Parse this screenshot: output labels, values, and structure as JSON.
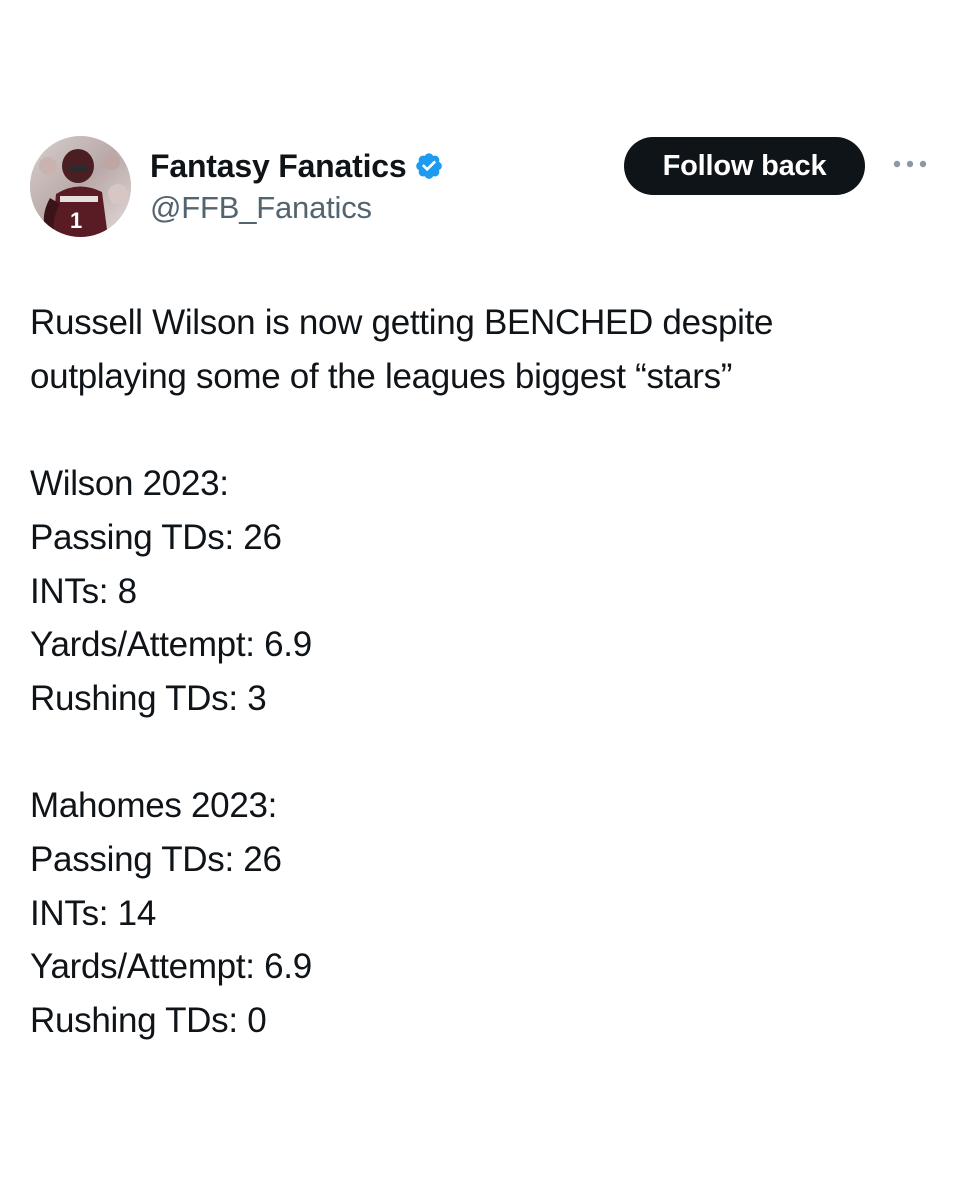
{
  "author": {
    "display_name": "Fantasy Fanatics",
    "handle": "@FFB_Fanatics",
    "verified": true,
    "verified_badge_color": "#1d9bf0"
  },
  "actions": {
    "follow_label": "Follow back",
    "more_icon": "more-horizontal-icon"
  },
  "tweet": {
    "intro_lines": [
      "Russell Wilson is now getting BENCHED despite",
      "outplaying some of the leagues biggest “stars”"
    ],
    "wilson": {
      "heading": "Wilson 2023:",
      "stats": [
        "Passing TDs: 26",
        "INTs: 8",
        "Yards/Attempt: 6.9",
        "Rushing TDs: 3"
      ]
    },
    "mahomes": {
      "heading": "Mahomes 2023:",
      "stats": [
        "Passing TDs: 26",
        "INTs: 14",
        "Yards/Attempt: 6.9",
        "Rushing TDs: 0"
      ]
    }
  },
  "colors": {
    "text_primary": "#0f1419",
    "text_secondary": "#536471",
    "button_bg": "#0f1419",
    "button_text": "#ffffff"
  }
}
